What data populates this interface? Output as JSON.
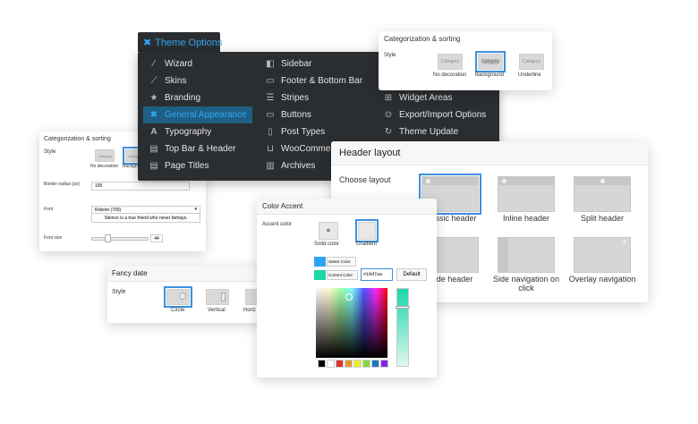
{
  "theme_menu": {
    "title": "Theme Options",
    "left_items": [
      {
        "label": "Wizard",
        "icon": "wand-icon"
      },
      {
        "label": "Skins",
        "icon": "brush-icon"
      },
      {
        "label": "Branding",
        "icon": "star-icon"
      },
      {
        "label": "General Appearance",
        "icon": "tools-icon",
        "active": true
      },
      {
        "label": "Typography",
        "icon": "text-icon"
      },
      {
        "label": "Top Bar & Header",
        "icon": "window-icon"
      },
      {
        "label": "Page Titles",
        "icon": "window-icon"
      }
    ],
    "mid_items": [
      {
        "label": "Sidebar",
        "icon": "sidebar-icon"
      },
      {
        "label": "Footer & Bottom Bar",
        "icon": "footer-icon"
      },
      {
        "label": "Stripes",
        "icon": "stripes-icon"
      },
      {
        "label": "Buttons",
        "icon": "button-icon"
      },
      {
        "label": "Post Types",
        "icon": "document-icon"
      },
      {
        "label": "WooCommerce",
        "icon": "cart-icon"
      },
      {
        "label": "Archives",
        "icon": "archive-icon"
      }
    ],
    "right_items": [
      {
        "label": "Widget Areas",
        "icon": "grid-icon"
      },
      {
        "label": "Export/Import Options",
        "icon": "download-icon"
      },
      {
        "label": "Theme Update",
        "icon": "refresh-icon"
      }
    ]
  },
  "cat_sort_top": {
    "title": "Categorization & sorting",
    "style_label": "Style",
    "options": [
      {
        "thumb": "Category",
        "label": "No decoration"
      },
      {
        "thumb": "Category",
        "label": "Background",
        "selected": true
      },
      {
        "thumb": "Category",
        "label": "Underline"
      }
    ]
  },
  "cat_sort_left": {
    "title": "Categorization & sorting",
    "style_label": "Style",
    "opt1_thumb": "Category",
    "opt1_label": "No decoration",
    "opt2_thumb": "Category",
    "opt2_label": "Backgro",
    "border_label": "Border radius (px)",
    "border_value": "100",
    "font_label": "Font",
    "font_value": "Roboto (700)",
    "font_preview": "Silence is a true friend who never betrays.",
    "font_size_label": "Font size",
    "font_size_value": "44"
  },
  "header_layout": {
    "title": "Header layout",
    "choose_label": "Choose layout",
    "options_row1": [
      "assic header",
      "Inline header",
      "Split header"
    ],
    "options_row2": [
      "ide header",
      "Side navigation on click",
      "Overlay navigation"
    ]
  },
  "color_accent": {
    "title": "Color Accent",
    "accent_label": "Accent color",
    "solid_label": "Solid color",
    "gradient_label": "Gradient",
    "select_color": "Select Color",
    "current_color": "Current Color",
    "hex_value": "#19d7aa",
    "default_button": "Default",
    "colors": {
      "select": "#2ea3f2",
      "current": "#19d7aa"
    },
    "swatches": [
      "#000000",
      "#ffffff",
      "#dd3333",
      "#dd9933",
      "#eeee22",
      "#81d742",
      "#1e73be",
      "#8224e3"
    ]
  },
  "fancy_date": {
    "title": "Fancy date",
    "style_label": "Style",
    "options": [
      "Circle",
      "Vertical",
      "Horiz"
    ]
  }
}
